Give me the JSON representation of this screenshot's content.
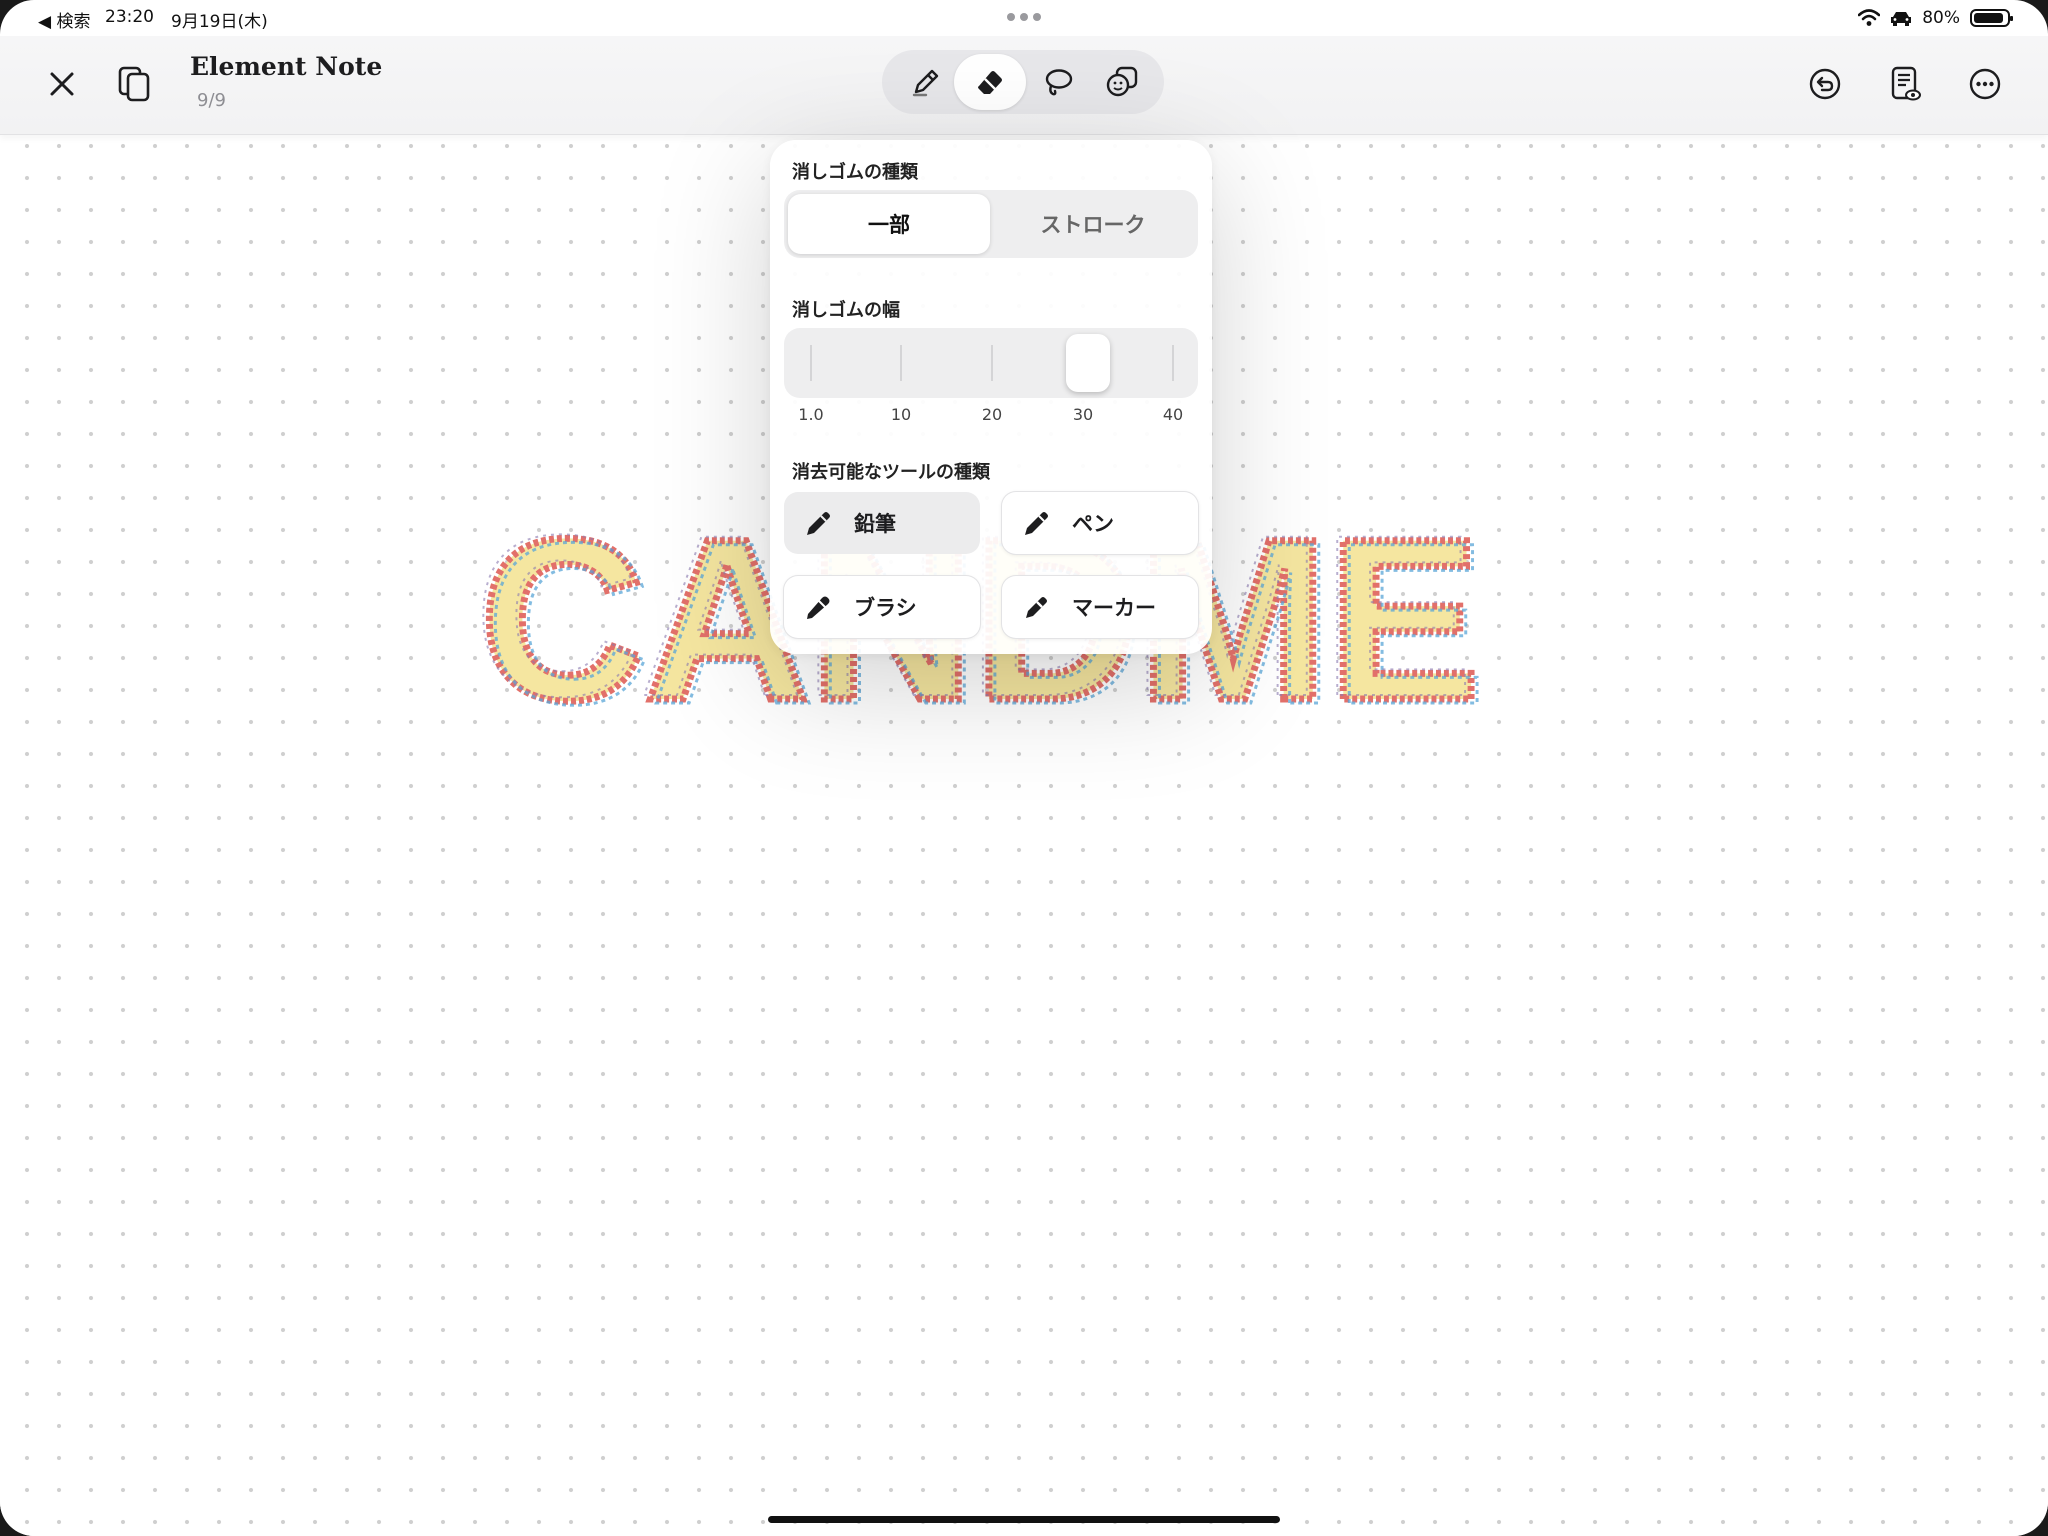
{
  "status_bar": {
    "back_label": "◀ 検索",
    "time": "23:20",
    "date": "9月19日(木)",
    "battery": "80%",
    "battery_level": 0.8
  },
  "header": {
    "title": "Element Note",
    "page_indicator": "9/9"
  },
  "toolbar": {
    "tools": [
      {
        "icon": "pencil-icon",
        "active": false
      },
      {
        "icon": "eraser-icon",
        "active": true
      },
      {
        "icon": "lasso-icon",
        "active": false
      },
      {
        "icon": "sticker-icon",
        "active": false
      }
    ],
    "right_icons": [
      "undo-icon",
      "page-view-icon",
      "more-icon"
    ]
  },
  "canvas": {
    "drawn_text": "CANDME"
  },
  "eraser_popover": {
    "type_label": "消しゴムの種類",
    "type_options": [
      "一部",
      "ストローク"
    ],
    "type_selected": "一部",
    "width_label": "消しゴムの幅",
    "width_scale": [
      "1.0",
      "10",
      "20",
      "30",
      "40"
    ],
    "width_value": 30,
    "erasable_label": "消去可能なツールの種類",
    "erasable_tools": [
      {
        "label": "鉛筆",
        "enabled": false
      },
      {
        "label": "ペン",
        "enabled": true
      },
      {
        "label": "ブラシ",
        "enabled": true
      },
      {
        "label": "マーカー",
        "enabled": true
      }
    ]
  },
  "colors": {
    "accent": "#1d1d1f",
    "crayon_fill": "#f5e6a0",
    "crayon_red": "#e2706a",
    "crayon_blue": "#5aa6d8",
    "crayon_purple": "#8a7ab0"
  }
}
